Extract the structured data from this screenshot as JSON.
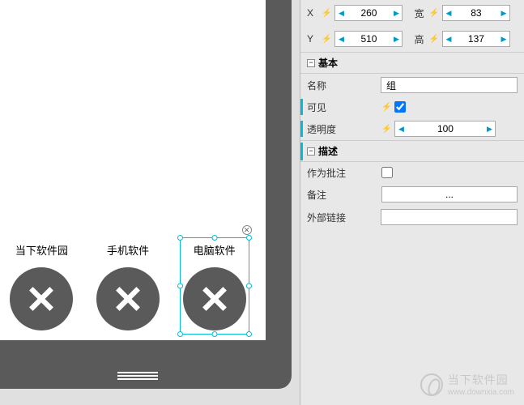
{
  "canvas": {
    "tabs": [
      {
        "label": "当下软件园"
      },
      {
        "label": "手机软件"
      },
      {
        "label": "电脑软件"
      }
    ],
    "selected_index": 2
  },
  "properties": {
    "coords": {
      "x_label": "X",
      "y_label": "Y",
      "w_label": "宽",
      "h_label": "高",
      "x": "260",
      "y": "510",
      "w": "83",
      "h": "137"
    },
    "sections": {
      "basic": {
        "title": "基本",
        "name_label": "名称",
        "name_value": "组",
        "visible_label": "可见",
        "visible_checked": true,
        "opacity_label": "透明度",
        "opacity_value": "100"
      },
      "description": {
        "title": "描述",
        "annotation_label": "作为批注",
        "annotation_checked": false,
        "remark_label": "备注",
        "remark_button": "...",
        "link_label": "外部链接",
        "link_value": ""
      }
    }
  },
  "watermark": {
    "cn": "当下软件园",
    "url": "www.downxia.com"
  }
}
